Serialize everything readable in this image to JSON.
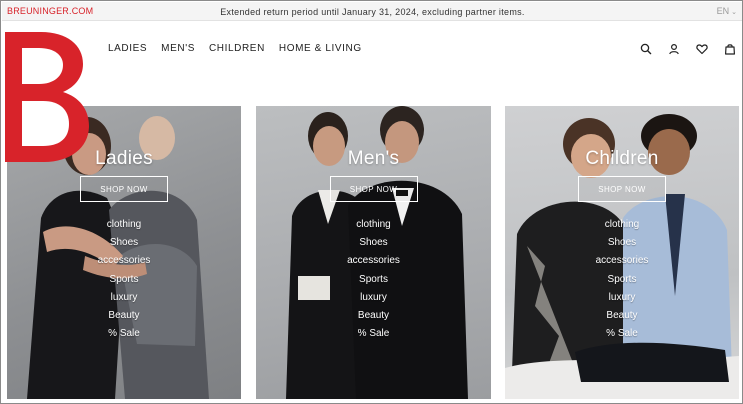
{
  "topbar": {
    "brand_link": "BREUNINGER.COM",
    "promo": "Extended return period until January 31, 2024, excluding partner items.",
    "language": "EN",
    "language_chevron": "⌄"
  },
  "nav": {
    "items": [
      {
        "label": "LADIES"
      },
      {
        "label": "MEN'S"
      },
      {
        "label": "CHILDREN"
      },
      {
        "label": "HOME & LIVING"
      }
    ]
  },
  "header_icons": [
    "search-icon",
    "account-icon",
    "wishlist-heart-icon",
    "bag-icon"
  ],
  "colors": {
    "brand_red": "#d8232a",
    "text_dark": "#222222",
    "white": "#ffffff"
  },
  "tiles": [
    {
      "title": "Ladies",
      "button": "SHOP NOW",
      "links": [
        "clothing",
        "Shoes",
        "accessories",
        "Sports",
        "luxury",
        "Beauty",
        "% Sale"
      ]
    },
    {
      "title": "Men's",
      "button": "SHOP NOW",
      "links": [
        "clothing",
        "Shoes",
        "accessories",
        "Sports",
        "luxury",
        "Beauty",
        "% Sale"
      ]
    },
    {
      "title": "Children",
      "button": "SHOP NOW",
      "links": [
        "clothing",
        "Shoes",
        "accessories",
        "Sports",
        "luxury",
        "Beauty",
        "% Sale"
      ]
    }
  ]
}
